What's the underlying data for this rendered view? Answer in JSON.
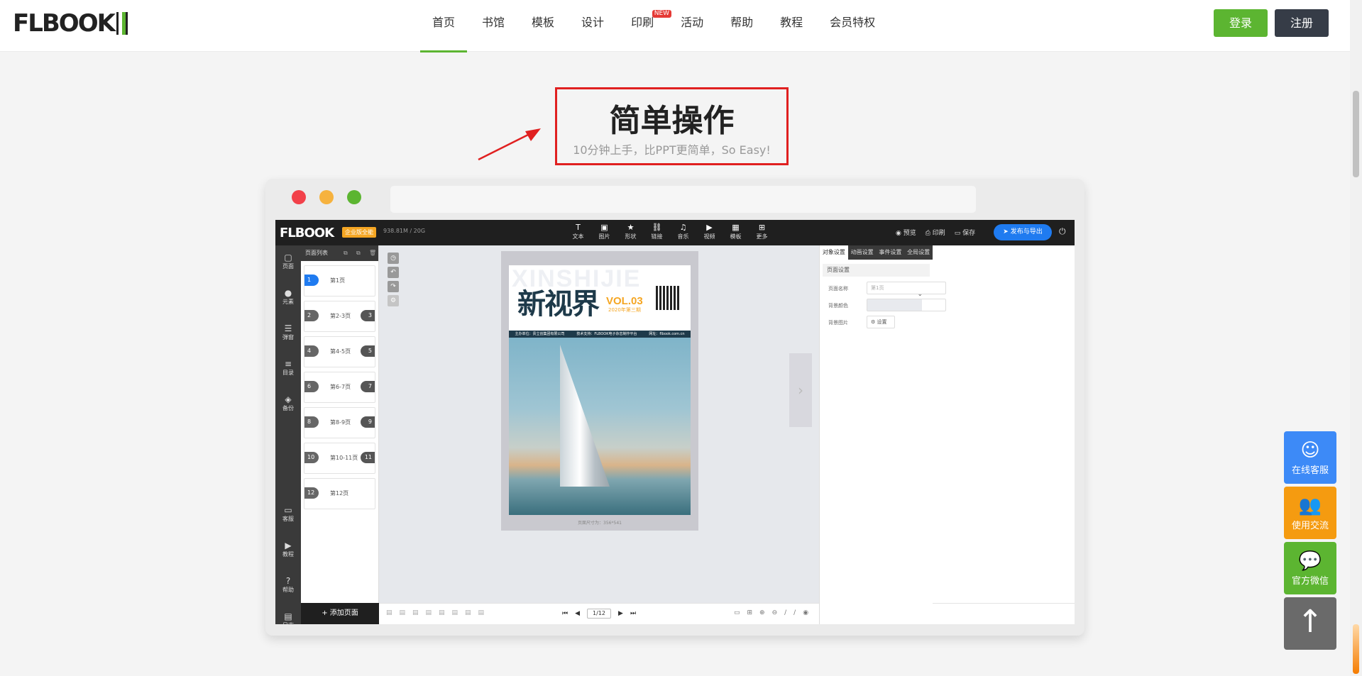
{
  "site": {
    "logo_text": "FLBOOK",
    "nav": [
      {
        "label": "首页",
        "active": true
      },
      {
        "label": "书馆"
      },
      {
        "label": "模板"
      },
      {
        "label": "设计"
      },
      {
        "label": "印刷",
        "badge": "NEW"
      },
      {
        "label": "活动"
      },
      {
        "label": "帮助"
      },
      {
        "label": "教程"
      },
      {
        "label": "会员特权"
      }
    ],
    "login_label": "登录",
    "register_label": "注册"
  },
  "hero": {
    "title": "简单操作",
    "subtitle": "10分钟上手，比PPT更简单，So Easy!"
  },
  "editor": {
    "logo_text": "FLBOOK",
    "enterprise_badge": "企业版全能",
    "storage": "938.81M / 20G",
    "tools": [
      {
        "icon": "T",
        "label": "文本"
      },
      {
        "icon": "▣",
        "label": "图片"
      },
      {
        "icon": "★",
        "label": "形状"
      },
      {
        "icon": "⛓",
        "label": "链接"
      },
      {
        "icon": "♫",
        "label": "音乐"
      },
      {
        "icon": "▶",
        "label": "视频"
      },
      {
        "icon": "▦",
        "label": "模板"
      },
      {
        "icon": "⊞",
        "label": "更多"
      }
    ],
    "right_tools": [
      "◉ 预览",
      "⎙ 印刷",
      "▭ 保存"
    ],
    "publish_label": "➤ 发布与导出",
    "sidebar": [
      {
        "icon": "▢",
        "label": "页面"
      },
      {
        "icon": "●",
        "label": "元素"
      },
      {
        "icon": "☰",
        "label": "弹窗"
      },
      {
        "icon": "≡",
        "label": "目录"
      },
      {
        "icon": "◈",
        "label": "备份"
      }
    ],
    "sidebar_bottom": [
      {
        "icon": "▭",
        "label": "客服"
      },
      {
        "icon": "▶",
        "label": "教程"
      },
      {
        "icon": "?",
        "label": "帮助"
      },
      {
        "icon": "▤",
        "label": "日志"
      }
    ],
    "pages_title": "页面列表",
    "pages": [
      {
        "num": "1",
        "label": "第1页",
        "right": ""
      },
      {
        "num": "2",
        "label": "第2-3页",
        "right": "3"
      },
      {
        "num": "4",
        "label": "第4-5页",
        "right": "5"
      },
      {
        "num": "6",
        "label": "第6-7页",
        "right": "7"
      },
      {
        "num": "8",
        "label": "第8-9页",
        "right": "9"
      },
      {
        "num": "10",
        "label": "第10-11页",
        "right": "11"
      },
      {
        "num": "12",
        "label": "第12页",
        "right": ""
      }
    ],
    "add_page_label": "+ 添加页面",
    "cover": {
      "watermark": "XINSHIJIE",
      "title": "新视界",
      "vol": "VOL.03",
      "issue": "2020年第三期",
      "strip_left": "主办单位：贵立创集团有限公司",
      "strip_mid": "技术支持：FLBOOK电子杂志制作平台",
      "strip_right": "网址：flbook.com.cn"
    },
    "page_size_note": "页面尺寸为：356*541",
    "pager": {
      "current": "1/12"
    },
    "right_tabs": [
      "对象设置",
      "动画设置",
      "事件设置",
      "全局设置"
    ],
    "panel_section": "页面设置",
    "panel_rows": [
      {
        "key": "页面名称",
        "value": "第1页"
      },
      {
        "key": "背景颜色",
        "value": ""
      },
      {
        "key": "背景图片",
        "value": "⚙ 设置"
      }
    ]
  },
  "float_buttons": [
    {
      "label": "在线客服",
      "icon": "qq-icon",
      "color": "#3d8af7"
    },
    {
      "label": "使用交流",
      "icon": "users-icon",
      "color": "#f59b10"
    },
    {
      "label": "官方微信",
      "icon": "wechat-icon",
      "color": "#5cb531"
    },
    {
      "label": "",
      "icon": "arrow-up-icon",
      "color": "#6a6a6a"
    }
  ]
}
